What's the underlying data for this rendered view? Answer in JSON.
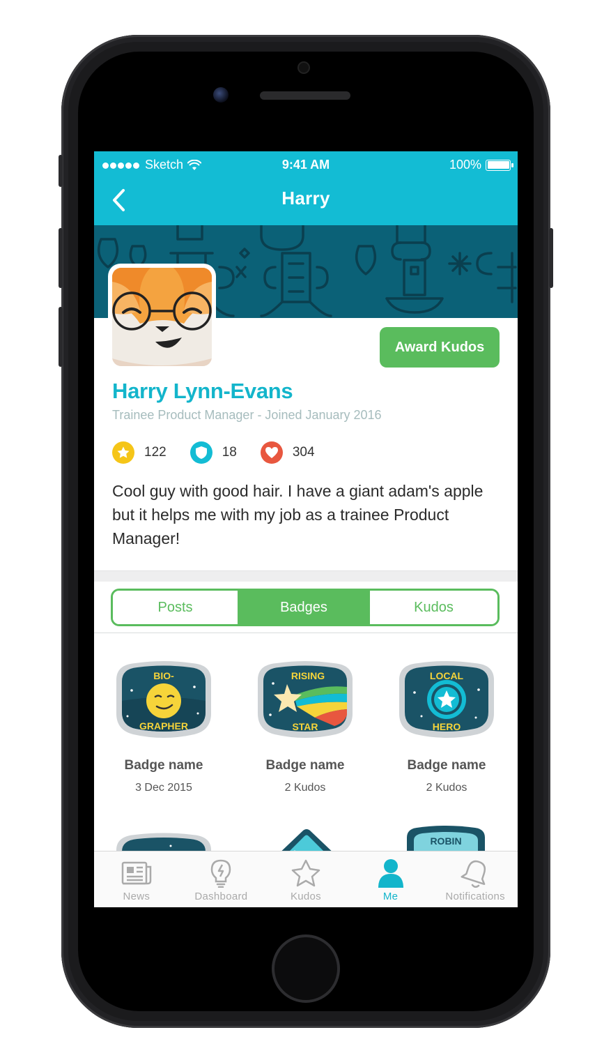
{
  "status_bar": {
    "carrier": "Sketch",
    "time": "9:41 AM",
    "battery": "100%"
  },
  "nav": {
    "title": "Harry",
    "back_icon": "chevron-left-icon"
  },
  "profile": {
    "name": "Harry Lynn-Evans",
    "subtitle": "Trainee Product Manager - Joined January 2016",
    "award_label": "Award Kudos",
    "stats": [
      {
        "icon": "star-icon",
        "value": "122",
        "color": "#f5c518"
      },
      {
        "icon": "shield-icon",
        "value": "18",
        "color": "#13bcd4"
      },
      {
        "icon": "heart-icon",
        "value": "304",
        "color": "#e8573f"
      }
    ],
    "bio": "Cool guy with good hair. I have a giant adam's apple but it helps me with my job as a trainee Product Manager!"
  },
  "tabs": [
    {
      "label": "Posts",
      "active": false
    },
    {
      "label": "Badges",
      "active": true
    },
    {
      "label": "Kudos",
      "active": false
    }
  ],
  "badges": [
    {
      "art_top": "BIO-",
      "art_bottom": "GRAPHER",
      "name": "Badge name",
      "sub": "3 Dec 2015"
    },
    {
      "art_top": "RISING",
      "art_bottom": "STAR",
      "name": "Badge name",
      "sub": "2 Kudos"
    },
    {
      "art_top": "LOCAL",
      "art_bottom": "HERO",
      "name": "Badge name",
      "sub": "2 Kudos"
    }
  ],
  "partial_badges": {
    "third_label": "ROBIN"
  },
  "tab_bar": [
    {
      "label": "News",
      "icon": "newspaper-icon",
      "active": false
    },
    {
      "label": "Dashboard",
      "icon": "lightbulb-icon",
      "active": false
    },
    {
      "label": "Kudos",
      "icon": "star-outline-icon",
      "active": false
    },
    {
      "label": "Me",
      "icon": "person-icon",
      "active": true
    },
    {
      "label": "Notifications",
      "icon": "bell-icon",
      "active": false
    }
  ],
  "colors": {
    "brand": "#13bcd4",
    "accent_green": "#5abc5d",
    "banner": "#0b6177"
  }
}
